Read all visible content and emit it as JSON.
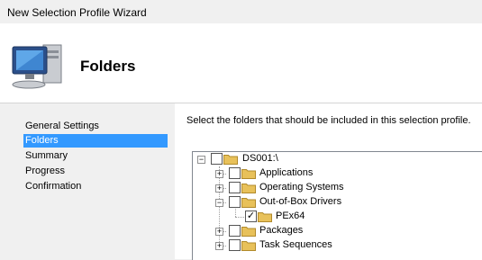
{
  "window": {
    "title": "New Selection Profile Wizard"
  },
  "header": {
    "heading": "Folders",
    "icon": "computer-icon"
  },
  "nav": {
    "items": [
      {
        "label": "General Settings",
        "selected": false
      },
      {
        "label": "Folders",
        "selected": true
      },
      {
        "label": "Summary",
        "selected": false
      },
      {
        "label": "Progress",
        "selected": false
      },
      {
        "label": "Confirmation",
        "selected": false
      }
    ]
  },
  "content": {
    "instruction": "Select the folders that should be included in this selection profile."
  },
  "tree": {
    "root": {
      "label": "DS001:\\",
      "expanded": true,
      "checked": false
    },
    "children": [
      {
        "label": "Applications",
        "expanded": false,
        "checked": false
      },
      {
        "label": "Operating Systems",
        "expanded": false,
        "checked": false
      },
      {
        "label": "Out-of-Box Drivers",
        "expanded": true,
        "checked": false
      },
      {
        "label": "PEx64",
        "checked": true
      },
      {
        "label": "Packages",
        "expanded": false,
        "checked": false
      },
      {
        "label": "Task Sequences",
        "expanded": false,
        "checked": false
      }
    ]
  },
  "colors": {
    "selection": "#3399ff",
    "folder": "#e8c15a"
  }
}
